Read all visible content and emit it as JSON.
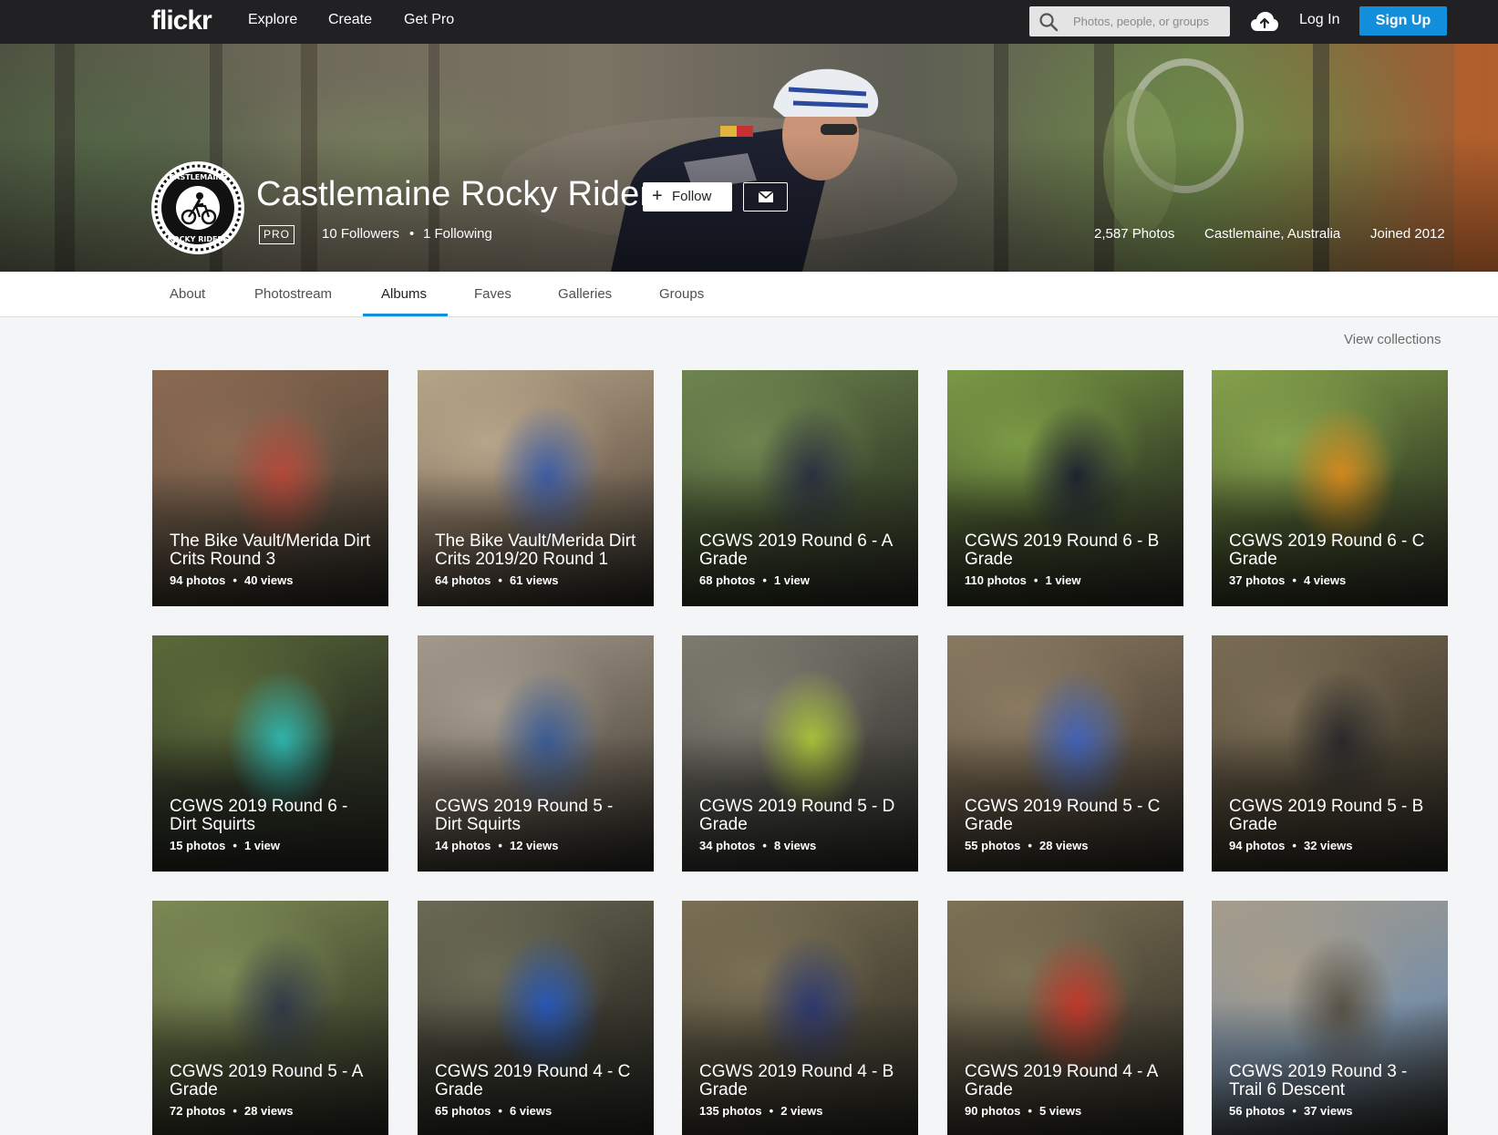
{
  "topbar": {
    "logo": "flickr",
    "nav": [
      "Explore",
      "Create",
      "Get Pro"
    ],
    "search_placeholder": "Photos, people, or groups",
    "login": "Log In",
    "signup": "Sign Up"
  },
  "profile": {
    "name": "Castlemaine Rocky Riders",
    "pro": "PRO",
    "followers": "10 Followers",
    "following": "1 Following",
    "follow_label": "Follow",
    "photos": "2,587 Photos",
    "location": "Castlemaine, Australia",
    "joined": "Joined 2012",
    "avatar_text_top": "CASTLEMAINE",
    "avatar_text_bottom": "ROCKY RIDERS"
  },
  "subnav": {
    "tabs": [
      "About",
      "Photostream",
      "Albums",
      "Faves",
      "Galleries",
      "Groups"
    ],
    "active": "Albums"
  },
  "view_collections": "View collections",
  "albums": [
    {
      "title": "The Bike Vault/Merida Dirt Crits Round 3",
      "photos": "94 photos",
      "views": "40 views"
    },
    {
      "title": "The Bike Vault/Merida Dirt Crits 2019/20 Round 1",
      "photos": "64 photos",
      "views": "61 views"
    },
    {
      "title": "CGWS 2019 Round 6 - A Grade",
      "photos": "68 photos",
      "views": "1 view"
    },
    {
      "title": "CGWS 2019 Round 6 - B Grade",
      "photos": "110 photos",
      "views": "1 view"
    },
    {
      "title": "CGWS 2019 Round 6 - C Grade",
      "photos": "37 photos",
      "views": "4 views"
    },
    {
      "title": "CGWS 2019 Round 6 - Dirt Squirts",
      "photos": "15 photos",
      "views": "1 view"
    },
    {
      "title": "CGWS 2019 Round 5 - Dirt Squirts",
      "photos": "14 photos",
      "views": "12 views"
    },
    {
      "title": "CGWS 2019 Round 5 - D Grade",
      "photos": "34 photos",
      "views": "8 views"
    },
    {
      "title": "CGWS 2019 Round 5 - C Grade",
      "photos": "55 photos",
      "views": "28 views"
    },
    {
      "title": "CGWS 2019 Round 5 - B Grade",
      "photos": "94 photos",
      "views": "32 views"
    },
    {
      "title": "CGWS 2019 Round 5 - A Grade",
      "photos": "72 photos",
      "views": "28 views"
    },
    {
      "title": "CGWS 2019 Round 4 - C Grade",
      "photos": "65 photos",
      "views": "6 views"
    },
    {
      "title": "CGWS 2019 Round 4 - B Grade",
      "photos": "135 photos",
      "views": "2 views"
    },
    {
      "title": "CGWS 2019 Round 4 - A Grade",
      "photos": "90 photos",
      "views": "5 views"
    },
    {
      "title": "CGWS 2019 Round 3 - Trail 6 Descent",
      "photos": "56 photos",
      "views": "37 views"
    }
  ],
  "colors": {
    "topbar": "#212124",
    "accent": "#128fdc",
    "background": "#f3f5f6"
  }
}
